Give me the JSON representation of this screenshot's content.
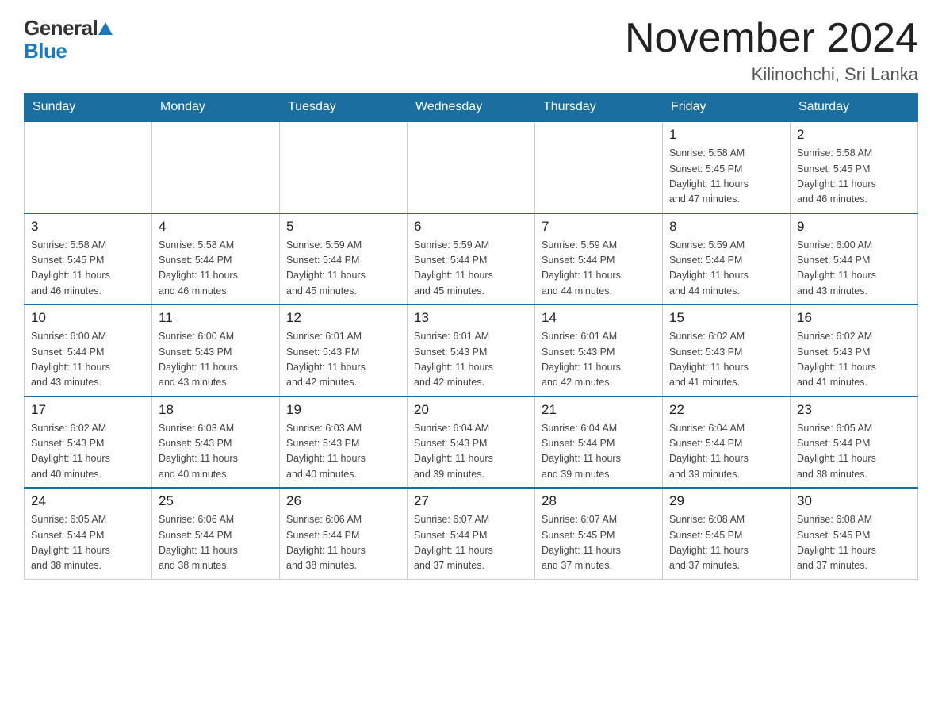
{
  "header": {
    "logo_general": "General",
    "logo_blue": "Blue",
    "month_title": "November 2024",
    "location": "Kilinochchi, Sri Lanka"
  },
  "days_of_week": [
    "Sunday",
    "Monday",
    "Tuesday",
    "Wednesday",
    "Thursday",
    "Friday",
    "Saturday"
  ],
  "weeks": [
    {
      "days": [
        {
          "number": "",
          "info": ""
        },
        {
          "number": "",
          "info": ""
        },
        {
          "number": "",
          "info": ""
        },
        {
          "number": "",
          "info": ""
        },
        {
          "number": "",
          "info": ""
        },
        {
          "number": "1",
          "info": "Sunrise: 5:58 AM\nSunset: 5:45 PM\nDaylight: 11 hours\nand 47 minutes."
        },
        {
          "number": "2",
          "info": "Sunrise: 5:58 AM\nSunset: 5:45 PM\nDaylight: 11 hours\nand 46 minutes."
        }
      ]
    },
    {
      "days": [
        {
          "number": "3",
          "info": "Sunrise: 5:58 AM\nSunset: 5:45 PM\nDaylight: 11 hours\nand 46 minutes."
        },
        {
          "number": "4",
          "info": "Sunrise: 5:58 AM\nSunset: 5:44 PM\nDaylight: 11 hours\nand 46 minutes."
        },
        {
          "number": "5",
          "info": "Sunrise: 5:59 AM\nSunset: 5:44 PM\nDaylight: 11 hours\nand 45 minutes."
        },
        {
          "number": "6",
          "info": "Sunrise: 5:59 AM\nSunset: 5:44 PM\nDaylight: 11 hours\nand 45 minutes."
        },
        {
          "number": "7",
          "info": "Sunrise: 5:59 AM\nSunset: 5:44 PM\nDaylight: 11 hours\nand 44 minutes."
        },
        {
          "number": "8",
          "info": "Sunrise: 5:59 AM\nSunset: 5:44 PM\nDaylight: 11 hours\nand 44 minutes."
        },
        {
          "number": "9",
          "info": "Sunrise: 6:00 AM\nSunset: 5:44 PM\nDaylight: 11 hours\nand 43 minutes."
        }
      ]
    },
    {
      "days": [
        {
          "number": "10",
          "info": "Sunrise: 6:00 AM\nSunset: 5:44 PM\nDaylight: 11 hours\nand 43 minutes."
        },
        {
          "number": "11",
          "info": "Sunrise: 6:00 AM\nSunset: 5:43 PM\nDaylight: 11 hours\nand 43 minutes."
        },
        {
          "number": "12",
          "info": "Sunrise: 6:01 AM\nSunset: 5:43 PM\nDaylight: 11 hours\nand 42 minutes."
        },
        {
          "number": "13",
          "info": "Sunrise: 6:01 AM\nSunset: 5:43 PM\nDaylight: 11 hours\nand 42 minutes."
        },
        {
          "number": "14",
          "info": "Sunrise: 6:01 AM\nSunset: 5:43 PM\nDaylight: 11 hours\nand 42 minutes."
        },
        {
          "number": "15",
          "info": "Sunrise: 6:02 AM\nSunset: 5:43 PM\nDaylight: 11 hours\nand 41 minutes."
        },
        {
          "number": "16",
          "info": "Sunrise: 6:02 AM\nSunset: 5:43 PM\nDaylight: 11 hours\nand 41 minutes."
        }
      ]
    },
    {
      "days": [
        {
          "number": "17",
          "info": "Sunrise: 6:02 AM\nSunset: 5:43 PM\nDaylight: 11 hours\nand 40 minutes."
        },
        {
          "number": "18",
          "info": "Sunrise: 6:03 AM\nSunset: 5:43 PM\nDaylight: 11 hours\nand 40 minutes."
        },
        {
          "number": "19",
          "info": "Sunrise: 6:03 AM\nSunset: 5:43 PM\nDaylight: 11 hours\nand 40 minutes."
        },
        {
          "number": "20",
          "info": "Sunrise: 6:04 AM\nSunset: 5:43 PM\nDaylight: 11 hours\nand 39 minutes."
        },
        {
          "number": "21",
          "info": "Sunrise: 6:04 AM\nSunset: 5:44 PM\nDaylight: 11 hours\nand 39 minutes."
        },
        {
          "number": "22",
          "info": "Sunrise: 6:04 AM\nSunset: 5:44 PM\nDaylight: 11 hours\nand 39 minutes."
        },
        {
          "number": "23",
          "info": "Sunrise: 6:05 AM\nSunset: 5:44 PM\nDaylight: 11 hours\nand 38 minutes."
        }
      ]
    },
    {
      "days": [
        {
          "number": "24",
          "info": "Sunrise: 6:05 AM\nSunset: 5:44 PM\nDaylight: 11 hours\nand 38 minutes."
        },
        {
          "number": "25",
          "info": "Sunrise: 6:06 AM\nSunset: 5:44 PM\nDaylight: 11 hours\nand 38 minutes."
        },
        {
          "number": "26",
          "info": "Sunrise: 6:06 AM\nSunset: 5:44 PM\nDaylight: 11 hours\nand 38 minutes."
        },
        {
          "number": "27",
          "info": "Sunrise: 6:07 AM\nSunset: 5:44 PM\nDaylight: 11 hours\nand 37 minutes."
        },
        {
          "number": "28",
          "info": "Sunrise: 6:07 AM\nSunset: 5:45 PM\nDaylight: 11 hours\nand 37 minutes."
        },
        {
          "number": "29",
          "info": "Sunrise: 6:08 AM\nSunset: 5:45 PM\nDaylight: 11 hours\nand 37 minutes."
        },
        {
          "number": "30",
          "info": "Sunrise: 6:08 AM\nSunset: 5:45 PM\nDaylight: 11 hours\nand 37 minutes."
        }
      ]
    }
  ]
}
